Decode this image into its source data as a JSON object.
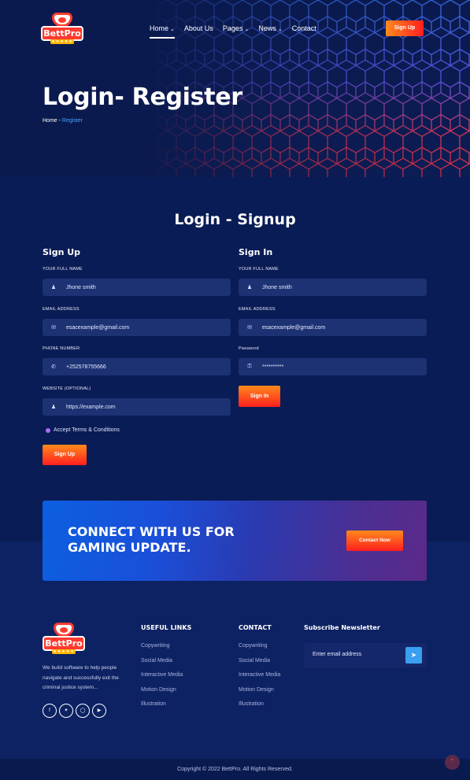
{
  "brand": {
    "name": "BettPro",
    "stars": "★★★★★"
  },
  "nav": {
    "items": [
      {
        "label": "Home",
        "dropdown": true
      },
      {
        "label": "About Us",
        "dropdown": false
      },
      {
        "label": "Pages",
        "dropdown": true
      },
      {
        "label": "News",
        "dropdown": true
      },
      {
        "label": "Contact",
        "dropdown": false
      }
    ],
    "signup_label": "Sign Up"
  },
  "hero": {
    "title": "Login- Register",
    "breadcrumb_home": "Home",
    "breadcrumb_sep": " - ",
    "breadcrumb_current": "Register"
  },
  "main": {
    "title": "Login - Signup",
    "signup": {
      "title": "Sign Up",
      "name_label": "YOUR FULL NAME",
      "name_value": "Jhone smith",
      "email_label": "EMAIL ADDRESS",
      "email_value": "esacexample@gmail.com",
      "phone_label": "PHONE NUMBER",
      "phone_value": "+252578755666",
      "website_label": "WEBSITE (OPTIONAL)",
      "website_value": "https://example.com",
      "terms_label": "Accept Terms & Conditions",
      "button_label": "Sign Up"
    },
    "signin": {
      "title": "Sign In",
      "name_label": "YOUR FULL NAME",
      "name_value": "Jhone smith",
      "email_label": "EMAIL ADDRESS",
      "email_value": "esacexample@gmail.com",
      "password_label": "Password",
      "password_value": "**********",
      "button_label": "Sign In"
    }
  },
  "cta": {
    "title": "CONNECT WITH US FOR GAMING UPDATE.",
    "button_label": "Contact Now"
  },
  "footer": {
    "description": "We build software to help people navigate and successfully exit the criminal justice system...",
    "socials": [
      "facebook-icon",
      "twitter-icon",
      "instagram-icon",
      "youtube-icon"
    ],
    "useful_links": {
      "title": "USEFUL LINKS",
      "items": [
        "Copywriting",
        "Social Media",
        "Interactive Media",
        "Motion Design",
        "Illustration"
      ]
    },
    "contact": {
      "title": "CONTACT",
      "items": [
        "Copywriting",
        "Social Media",
        "Interactive Media",
        "Motion Design",
        "Illustration"
      ]
    },
    "newsletter": {
      "title": "Subscribe Newsletter",
      "placeholder": "Enter email address"
    },
    "copyright": "Copyright © 2022 BettPro. All Rights Reserved."
  },
  "colors": {
    "accent_orange": "#ff8a1c",
    "accent_red": "#ff1f1f",
    "bg_navy": "#0a1c55",
    "field": "#1c3273",
    "link_blue": "#4aa0ff"
  }
}
